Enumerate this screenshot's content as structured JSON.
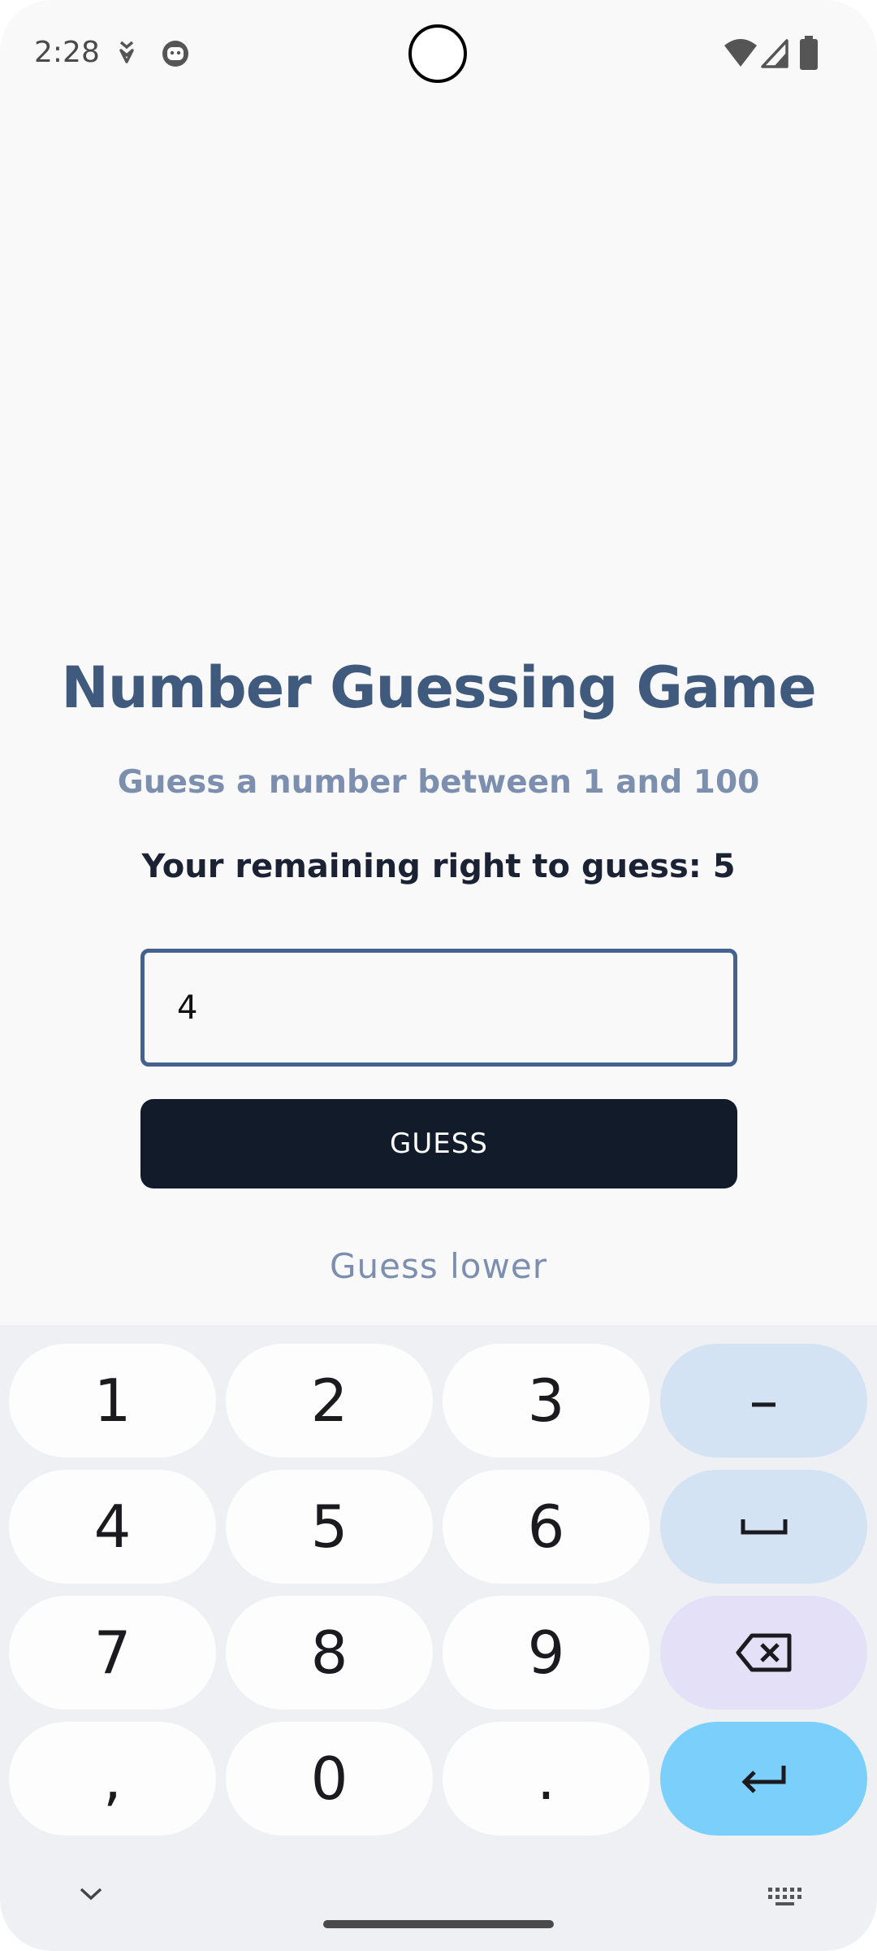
{
  "status_bar": {
    "time": "2:28",
    "icons": [
      "download-icon",
      "face-icon",
      "wifi-icon",
      "signal-icon",
      "battery-icon"
    ]
  },
  "game": {
    "title": "Number Guessing Game",
    "subtitle": "Guess a number between 1 and 100",
    "remaining_text": "Your remaining right to guess: 5",
    "input_value": "4",
    "button_label": "GUESS",
    "hint": "Guess lower"
  },
  "keyboard": {
    "keys": [
      "1",
      "2",
      "3",
      "–",
      "4",
      "5",
      "6",
      "space",
      "7",
      "8",
      "9",
      "backspace",
      ",",
      "0",
      ".",
      "enter"
    ],
    "row1": {
      "k1": "1",
      "k2": "2",
      "k3": "3",
      "dash": "–"
    },
    "row2": {
      "k4": "4",
      "k5": "5",
      "k6": "6"
    },
    "row3": {
      "k7": "7",
      "k8": "8",
      "k9": "9"
    },
    "row4": {
      "comma": ",",
      "k0": "0",
      "period": "."
    }
  },
  "colors": {
    "title": "#3f5a7d",
    "subtitle": "#7c8fae",
    "button_bg": "#111b2a",
    "input_border": "#44618f",
    "enter_key": "#7bd0fb",
    "func_key": "#d3e3f3",
    "delete_key": "#e3e0f8"
  }
}
